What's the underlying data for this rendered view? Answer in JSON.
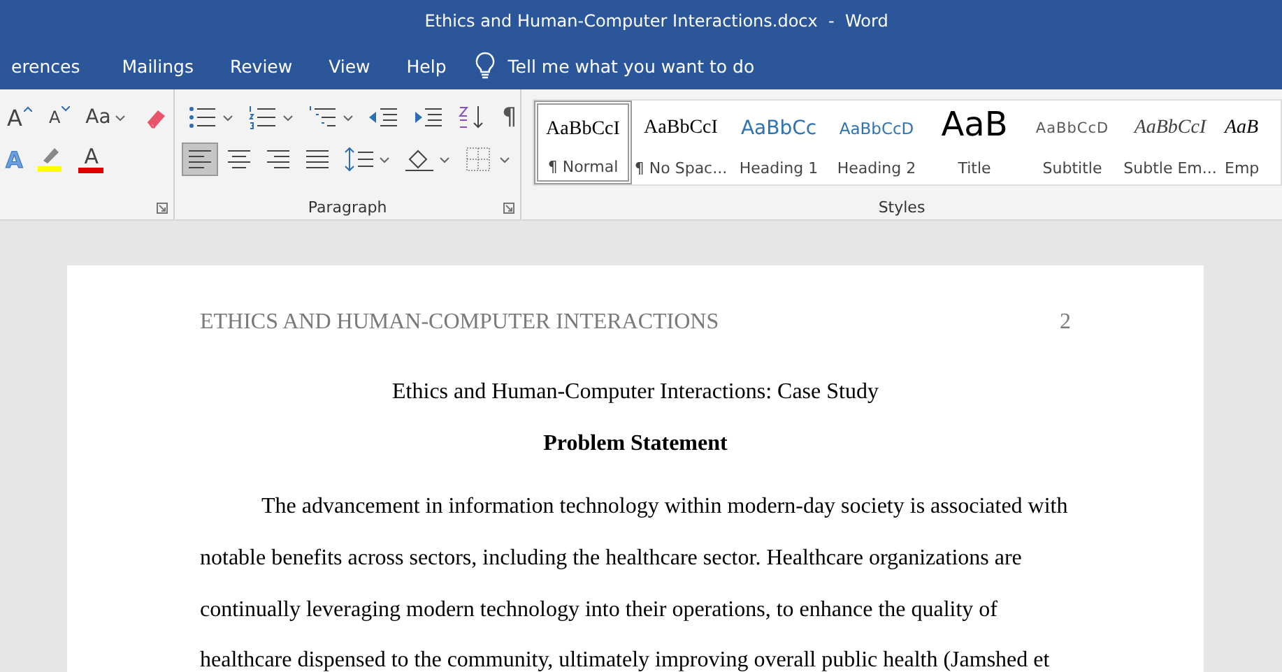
{
  "window": {
    "title": "Ethics and Human-Computer Interactions.docx  -  Word"
  },
  "tabs": [
    {
      "label": "erences",
      "selected": false
    },
    {
      "label": "Mailings",
      "selected": false
    },
    {
      "label": "Review",
      "selected": false
    },
    {
      "label": "View",
      "selected": false
    },
    {
      "label": "Help",
      "selected": false
    }
  ],
  "tell_me": {
    "placeholder": "Tell me what you want to do"
  },
  "font_group": {
    "row_1": [
      {
        "kind": "grow",
        "glyph": "A"
      },
      {
        "kind": "shrink",
        "glyph": "A"
      },
      {
        "kind": "case",
        "glyph": "Aa"
      },
      {
        "kind": "clear"
      }
    ],
    "row_2": [
      {
        "kind": "effects",
        "glyph": "A"
      },
      {
        "kind": "highlight",
        "color": "#ffff00"
      },
      {
        "kind": "fontcolor",
        "glyph": "A",
        "color": "#e00000"
      }
    ]
  },
  "paragraph_group": {
    "label": "Paragraph",
    "row_1": [
      {
        "kind": "bullets"
      },
      {
        "kind": "numbering"
      },
      {
        "kind": "multilevel"
      },
      {
        "kind": "outdent"
      },
      {
        "kind": "indent"
      },
      {
        "kind": "sort"
      },
      {
        "kind": "marks",
        "glyph": "¶"
      }
    ],
    "row_2": [
      {
        "kind": "left",
        "selected": true
      },
      {
        "kind": "center",
        "selected": false
      },
      {
        "kind": "right",
        "selected": false
      },
      {
        "kind": "justify",
        "selected": false
      },
      {
        "kind": "spacing"
      },
      {
        "kind": "shading"
      },
      {
        "kind": "borders"
      }
    ]
  },
  "styles": {
    "label": "Styles",
    "items": [
      {
        "kind": "normal",
        "preview": "AaBbCcI",
        "name": "¶ Normal",
        "selected": true
      },
      {
        "kind": "nospacing",
        "preview": "AaBbCcI",
        "name": "¶ No Spac...",
        "selected": false
      },
      {
        "kind": "heading1",
        "preview": "AaBbCc",
        "name": "Heading 1",
        "selected": false
      },
      {
        "kind": "heading2",
        "preview": "AaBbCcD",
        "name": "Heading 2",
        "selected": false
      },
      {
        "kind": "title",
        "preview": "AaB",
        "name": "Title",
        "selected": false
      },
      {
        "kind": "subtitle",
        "preview": "AaBbCcD",
        "name": "Subtitle",
        "selected": false
      },
      {
        "kind": "subtle",
        "preview": "AaBbCcI",
        "name": "Subtle Em...",
        "selected": false
      },
      {
        "kind": "emphasis",
        "preview": "AaB",
        "name": "Emp",
        "selected": false
      }
    ]
  },
  "document": {
    "running_head": "ETHICS AND HUMAN-COMPUTER INTERACTIONS",
    "page_number": "2",
    "title": "Ethics and Human-Computer Interactions: Case Study",
    "heading": "Problem Statement",
    "paragraph": "The advancement in information technology within modern-day society is associated with notable benefits across sectors, including the healthcare sector. Healthcare organizations are continually leveraging modern technology into their operations, to enhance the quality of healthcare dispensed to the community, ultimately improving overall public health (Jamshed et"
  }
}
